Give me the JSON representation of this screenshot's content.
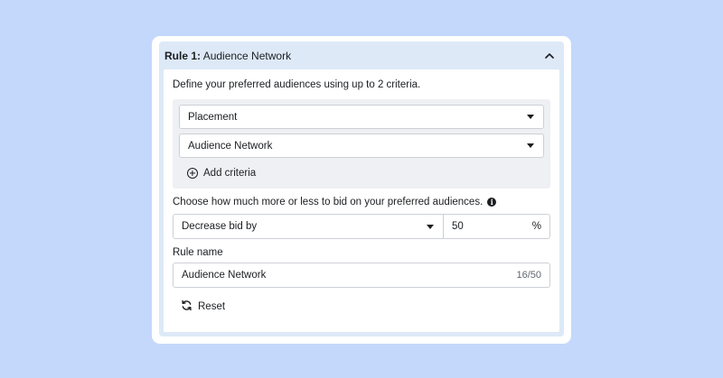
{
  "rule": {
    "title_prefix": "Rule 1:",
    "title_name": "Audience Network",
    "description": "Define your preferred audiences using up to 2 criteria.",
    "criteria": [
      {
        "value": "Placement"
      },
      {
        "value": "Audience Network"
      }
    ],
    "add_criteria_label": "Add criteria",
    "bid_instruction": "Choose how much more or less to bid on your preferred audiences.",
    "bid_type": "Decrease bid by",
    "bid_value": "50",
    "bid_unit": "%",
    "rule_name_label": "Rule name",
    "rule_name_value": "Audience Network",
    "rule_name_counter": "16/50",
    "reset_label": "Reset"
  },
  "icons": {
    "collapse": "chevron-up-icon",
    "caret": "caret-down-icon",
    "add": "plus-circle-icon",
    "info": "info-icon",
    "reset": "refresh-icon"
  }
}
